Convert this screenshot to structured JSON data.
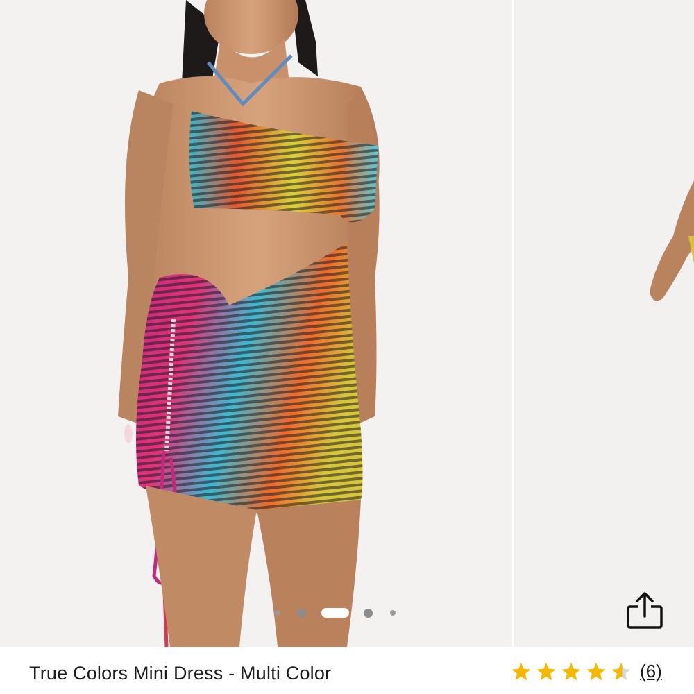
{
  "product": {
    "title": "True Colors Mini Dress - Multi Color",
    "rating": 4.5,
    "rating_max": 5,
    "review_count_label": "(6)"
  },
  "gallery": {
    "current_index": 3,
    "total": 5,
    "image_subject": "model wearing a multi color striped cut-out ruched mini dress"
  },
  "icons": {
    "share": "share-icon",
    "star": "star-icon"
  },
  "colors": {
    "star": "#f5b800",
    "dot": "#9a9a9a",
    "text": "#1c1c1c"
  }
}
